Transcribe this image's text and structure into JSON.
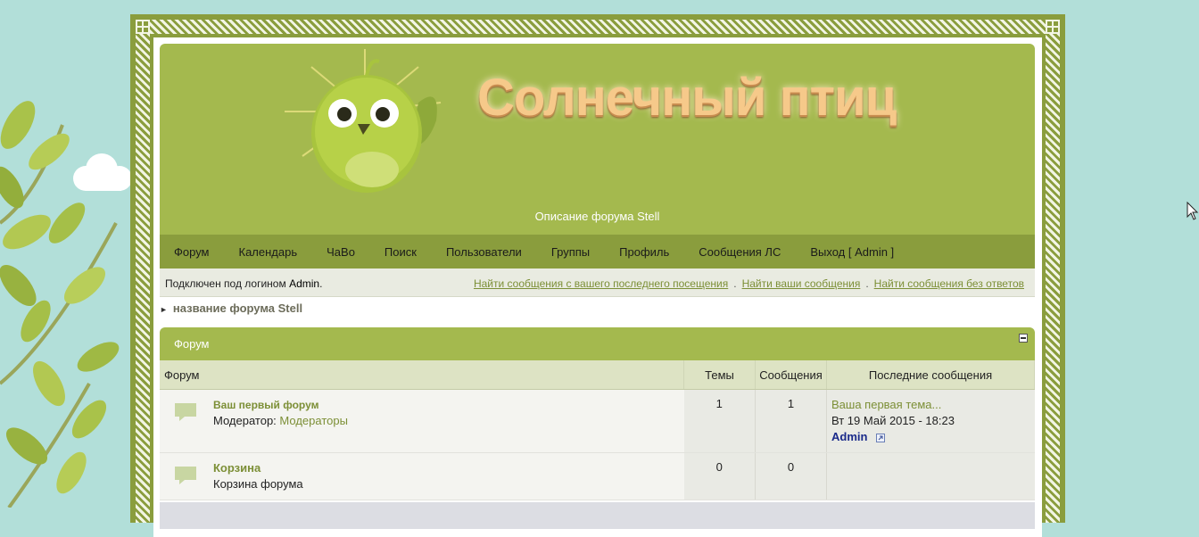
{
  "header": {
    "logo_text": "Солнечный птиц",
    "forum_description": "Описание форума Stell"
  },
  "nav": {
    "items": [
      "Форум",
      "Календарь",
      "ЧаВо",
      "Поиск",
      "Пользователи",
      "Группы",
      "Профиль",
      "Сообщения ЛС",
      "Выход [ Admin ]"
    ]
  },
  "infobar": {
    "logged_prefix": "Подключен под логином",
    "username": "Admin",
    "logged_suffix": ".",
    "links": [
      "Найти сообщения с вашего последнего посещения",
      "Найти ваши сообщения",
      "Найти сообщения без ответов"
    ],
    "separator": "."
  },
  "breadcrumb": {
    "arrow": "►",
    "label": "название форума Stell"
  },
  "category": {
    "title": "Форум",
    "columns": {
      "forum": "Форум",
      "topics": "Темы",
      "posts": "Сообщения",
      "last": "Последние сообщения"
    },
    "rows": [
      {
        "name": "Ваш первый форум",
        "desc_prefix": "Модератор:",
        "desc_link": "Модераторы",
        "topics": "1",
        "posts": "1",
        "last_topic": "Ваша первая тема...",
        "last_date": "Вт 19 Май 2015 - 18:23",
        "last_user": "Admin"
      },
      {
        "name": "Корзина",
        "desc": "Корзина форума",
        "topics": "0",
        "posts": "0"
      }
    ]
  },
  "colors": {
    "background": "#b2dfd9",
    "banner": "#a4b94e",
    "navbar": "#8a9d3d",
    "link": "#7c8f36",
    "user": "#1a2a8a"
  }
}
